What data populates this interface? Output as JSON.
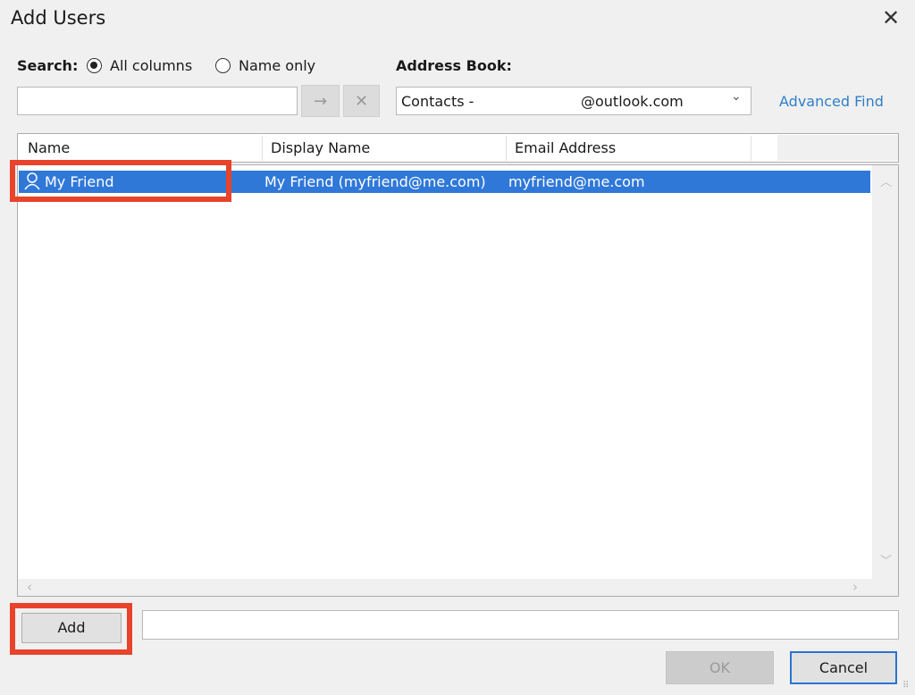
{
  "dialog": {
    "title": "Add Users",
    "close_icon": "close-icon"
  },
  "search": {
    "label": "Search:",
    "options": [
      {
        "label": "All columns",
        "selected": true
      },
      {
        "label": "Name only",
        "selected": false
      }
    ],
    "value": "",
    "go_icon": "arrow-right-icon",
    "clear_icon": "x-icon"
  },
  "address_book": {
    "label": "Address Book:",
    "value_prefix": "Contacts - ",
    "value_suffix": "@outlook.com",
    "advanced_find": "Advanced Find"
  },
  "table": {
    "columns": [
      "Name",
      "Display Name",
      "Email Address"
    ],
    "rows": [
      {
        "name": "My Friend",
        "display_name": "My Friend (myfriend@me.com)",
        "email": "myfriend@me.com",
        "selected": true
      }
    ]
  },
  "footer": {
    "add_label": "Add",
    "recipients_value": "",
    "ok_label": "OK",
    "cancel_label": "Cancel",
    "ok_enabled": false
  },
  "colors": {
    "selection": "#3078d8",
    "highlight": "#e8432b",
    "link": "#2f7fc8"
  }
}
